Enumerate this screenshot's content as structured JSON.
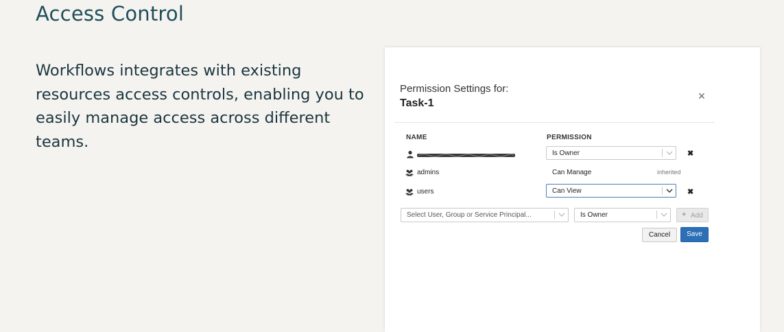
{
  "slide": {
    "title": "Access Control",
    "description": "Workflows integrates with existing resources access controls, enabling you to easily manage access across different teams."
  },
  "dialog": {
    "header_label": "Permission Settings for:",
    "task_name": "Task-1",
    "close_glyph": "×",
    "columns": {
      "name": "NAME",
      "permission": "PERMISSION"
    },
    "rows": [
      {
        "icon": "user-icon",
        "name": "",
        "permission": "Is Owner",
        "editable": true,
        "removable": true
      },
      {
        "icon": "group-icon",
        "name": "admins",
        "permission": "Can Manage",
        "note": "inherited",
        "editable": false
      },
      {
        "icon": "group-icon",
        "name": "users",
        "permission": "Can View",
        "editable": true,
        "removable": true,
        "focused": true
      }
    ],
    "remove_glyph": "✖",
    "add_row": {
      "principal_placeholder": "Select User, Group or Service Principal...",
      "permission_value": "Is Owner",
      "add_plus": "+",
      "add_label": "Add"
    },
    "buttons": {
      "cancel": "Cancel",
      "save": "Save"
    },
    "colors": {
      "primary": "#2c6fb7",
      "focus_border": "#4a7fb5",
      "title_text": "#1f4e5a"
    }
  }
}
